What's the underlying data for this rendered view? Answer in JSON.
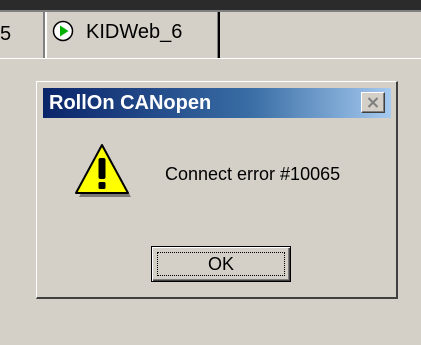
{
  "tabs": {
    "prev_label": "5",
    "active_label": "KIDWeb_6",
    "active_icon": "green-play-icon"
  },
  "dialog": {
    "title": "RollOn CANopen",
    "close_icon": "close-icon",
    "icon": "warning-icon",
    "message": "Connect error #10065",
    "ok_label": "OK"
  },
  "colors": {
    "titlebar_start": "#0a246a",
    "titlebar_end": "#a6caf0",
    "window_bg": "#d4d0c8",
    "warning_fill": "#ffff00",
    "play_green": "#00b000"
  }
}
